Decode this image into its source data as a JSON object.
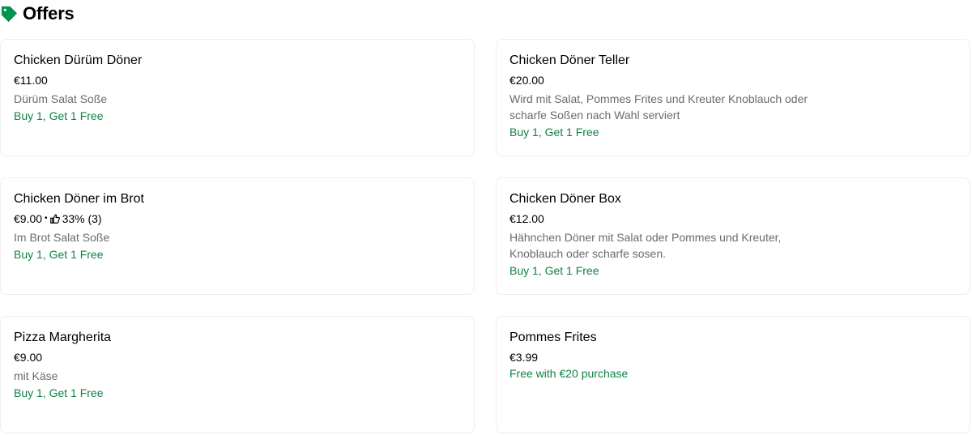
{
  "header": {
    "title": "Offers",
    "icon": "tag-icon",
    "icon_color": "#05944f"
  },
  "colors": {
    "offer_green": "#0e8345",
    "desc_gray": "#6b6b6b",
    "border": "#eeeeee"
  },
  "items": [
    {
      "title": "Chicken Dürüm Döner",
      "price": "€11.00",
      "rating": null,
      "description": "Dürüm Salat Soße",
      "offer": "Buy 1, Get 1 Free"
    },
    {
      "title": "Chicken Döner Teller",
      "price": "€20.00",
      "rating": null,
      "description": "Wird mit Salat, Pommes Frites und Kreuter Knoblauch oder scharfe Soßen nach Wahl serviert",
      "offer": "Buy 1, Get 1 Free"
    },
    {
      "title": "Chicken Döner im Brot",
      "price": "€9.00",
      "rating": "33% (3)",
      "description": "Im Brot Salat Soße",
      "offer": "Buy 1, Get 1 Free"
    },
    {
      "title": "Chicken Döner Box",
      "price": "€12.00",
      "rating": null,
      "description": "Hähnchen Döner mit Salat oder Pommes und Kreuter, Knoblauch oder scharfe sosen.",
      "offer": "Buy 1, Get 1 Free"
    },
    {
      "title": "Pizza Margherita",
      "price": "€9.00",
      "rating": null,
      "description": "mit Käse",
      "offer": "Buy 1, Get 1 Free"
    },
    {
      "title": "Pommes Frites",
      "price": "€3.99",
      "rating": null,
      "description": null,
      "offer": "Free with €20 purchase"
    }
  ]
}
